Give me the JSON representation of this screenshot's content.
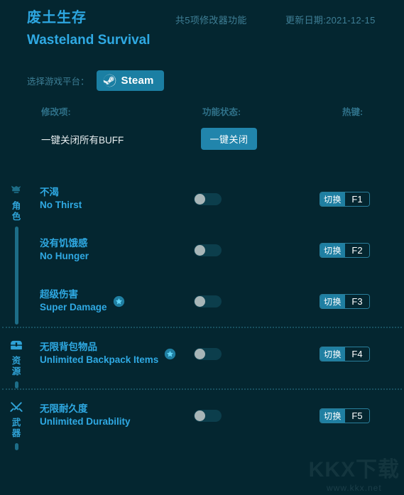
{
  "header": {
    "title_cn": "废土生存",
    "title_en": "Wasteland Survival",
    "feature_count_text": "共5项修改器功能",
    "update_date_text": "更新日期:2021-12-15",
    "accent_color": "#2fa9e3",
    "background_color": "#042630"
  },
  "platform": {
    "label": "选择游戏平台：",
    "selected": "Steam",
    "icon": "steam-icon",
    "button_color": "#1b7fa3"
  },
  "columns": {
    "item": "修改项:",
    "status": "功能状态:",
    "hotkey": "热键:"
  },
  "global_action": {
    "label": "一键关闭所有BUFF",
    "button_label": "一键关闭",
    "button_color": "#2185ac"
  },
  "sections": [
    {
      "id": "character",
      "icon": "character-icon",
      "label": "角色",
      "rows": [
        {
          "name_cn": "不渴",
          "name_en": "No Thirst",
          "starred": false,
          "toggle_on": false,
          "hotkey_action": "切换",
          "hotkey_key": "F1"
        },
        {
          "name_cn": "没有饥饿感",
          "name_en": "No Hunger",
          "starred": false,
          "toggle_on": false,
          "hotkey_action": "切换",
          "hotkey_key": "F2"
        },
        {
          "name_cn": "超级伤害",
          "name_en": "Super Damage",
          "starred": true,
          "toggle_on": false,
          "hotkey_action": "切换",
          "hotkey_key": "F3"
        }
      ]
    },
    {
      "id": "resources",
      "icon": "chest-icon",
      "label": "资源",
      "rows": [
        {
          "name_cn": "无限背包物品",
          "name_en": "Unlimited Backpack Items",
          "starred": true,
          "toggle_on": false,
          "hotkey_action": "切换",
          "hotkey_key": "F4"
        }
      ]
    },
    {
      "id": "weapons",
      "icon": "crossed-swords-icon",
      "label": "武器",
      "rows": [
        {
          "name_cn": "无限耐久度",
          "name_en": "Unlimited Durability",
          "starred": false,
          "toggle_on": false,
          "hotkey_action": "切换",
          "hotkey_key": "F5"
        }
      ]
    }
  ],
  "watermark": {
    "logo": "KKX下载",
    "url": "www.kkx.net"
  }
}
